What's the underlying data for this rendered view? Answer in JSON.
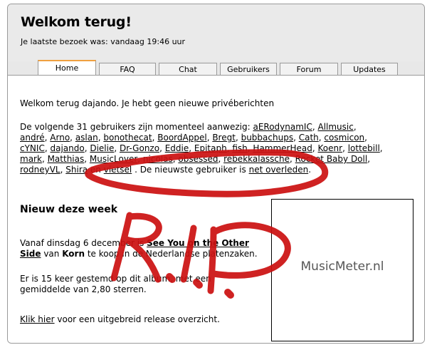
{
  "header": {
    "title": "Welkom terug!",
    "last_visit": "Je laatste bezoek was: vandaag 19:46 uur"
  },
  "tabs": [
    {
      "label": "Home",
      "active": true
    },
    {
      "label": "FAQ",
      "active": false
    },
    {
      "label": "Chat",
      "active": false
    },
    {
      "label": "Gebruikers",
      "active": false
    },
    {
      "label": "Forum",
      "active": false
    },
    {
      "label": "Updates",
      "active": false
    }
  ],
  "welcome": "Welkom terug dajando. Je hebt geen nieuwe privéberichten",
  "online": {
    "intro": "De volgende 31 gebruikers zijn momenteel aanwezig:",
    "users": [
      "aERodynamIC",
      "Allmusic",
      "andré",
      "Arno",
      "aslan",
      "bonothecat",
      "BoordAppel",
      "Bregt",
      "bubbachups",
      "Cath",
      "cosmicon",
      "cYNIC",
      "dajando",
      "Dielie",
      "Dr-Gonzo",
      "Eddie",
      "Epitaph",
      "fish",
      "HammerHead",
      "Koenr",
      "lottebill",
      "mark",
      "Matthias",
      "MusicLover",
      "nicolas",
      "obsessed",
      "rebekkalassche",
      "Rocket Baby Doll",
      "rodneyVL",
      "Shira",
      "vietsel"
    ],
    "and_word": "en",
    "newest_label": ". De nieuwste gebruiker is",
    "newest_user": "net overleden",
    "end": "."
  },
  "new_week": {
    "heading": "Nieuw deze week",
    "line_prefix": "Vanaf dinsdag 6 december is",
    "album": "See You on the Other Side",
    "by_word": "van",
    "artist": "Korn",
    "line_suffix": "te koop in de Nederlandse platenzaken.",
    "rating": "Er is 15 keer gestemd op dit album, met een gemiddelde van 2,80 sterren.",
    "link": "Klik hier",
    "link_suffix": "voor een uitgebreid release overzicht."
  },
  "album_box": {
    "label": "MusicMeter.nl"
  },
  "graffiti": {
    "text": "R.I.P.",
    "color": "#cc1010"
  }
}
